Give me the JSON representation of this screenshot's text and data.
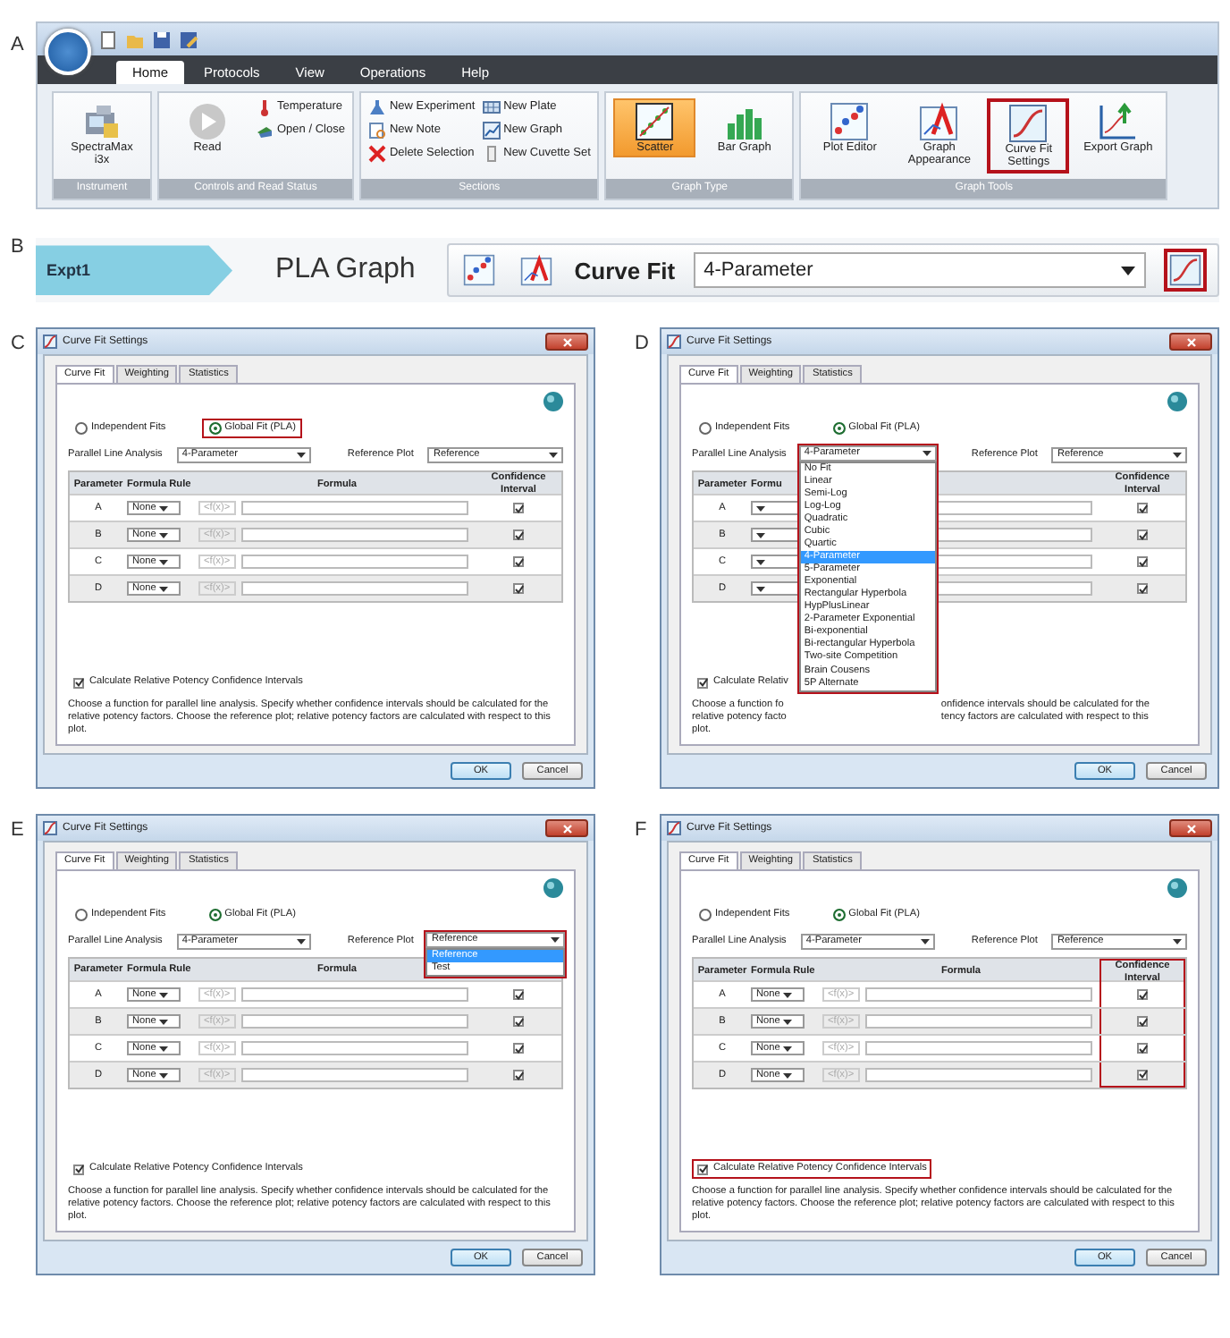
{
  "ribbon": {
    "panel_label": "A",
    "tabs": [
      {
        "label": "Home",
        "selected": true
      },
      {
        "label": "Protocols",
        "selected": false
      },
      {
        "label": "View",
        "selected": false
      },
      {
        "label": "Operations",
        "selected": false
      },
      {
        "label": "Help",
        "selected": false
      }
    ],
    "groups": [
      {
        "label": "Instrument",
        "items": [
          {
            "kind": "large",
            "label": "SpectraMax i3x",
            "selected": false,
            "highlighted": false
          }
        ]
      },
      {
        "label": "Controls and Read Status",
        "items": [
          {
            "kind": "large",
            "label": "Read",
            "selected": false,
            "highlighted": false
          },
          {
            "kind": "small",
            "label": "Temperature"
          },
          {
            "kind": "small",
            "label": "Open / Close"
          }
        ]
      },
      {
        "label": "Sections",
        "items": [
          {
            "kind": "small",
            "label": "New Experiment"
          },
          {
            "kind": "small",
            "label": "New Note"
          },
          {
            "kind": "small",
            "label": "Delete Selection"
          },
          {
            "kind": "small",
            "label": "New Plate"
          },
          {
            "kind": "small",
            "label": "New Graph"
          },
          {
            "kind": "small",
            "label": "New Cuvette Set"
          }
        ]
      },
      {
        "label": "Graph Type",
        "items": [
          {
            "kind": "large",
            "label": "Scatter",
            "selected": true,
            "highlighted": false
          },
          {
            "kind": "large",
            "label": "Bar Graph",
            "selected": false,
            "highlighted": false
          }
        ]
      },
      {
        "label": "Graph Tools",
        "items": [
          {
            "kind": "large",
            "label": "Plot Editor",
            "selected": false,
            "highlighted": false
          },
          {
            "kind": "large",
            "label": "Graph Appearance",
            "selected": false,
            "highlighted": false
          },
          {
            "kind": "large",
            "label": "Curve Fit Settings",
            "selected": false,
            "highlighted": true
          },
          {
            "kind": "large",
            "label": "Export Graph",
            "selected": false,
            "highlighted": false
          }
        ]
      }
    ]
  },
  "graph_bar": {
    "panel_label": "B",
    "experiment": "Expt1",
    "title": "PLA Graph",
    "curve_fit_label": "Curve Fit",
    "curve_fit_value": "4-Parameter",
    "settings_highlighted": true
  },
  "dialogs": [
    {
      "panel_label": "C",
      "title": "Curve Fit Settings",
      "tabs": [
        {
          "label": "Curve Fit",
          "selected": true
        },
        {
          "label": "Weighting",
          "selected": false
        },
        {
          "label": "Statistics",
          "selected": false
        }
      ],
      "fit_options": [
        {
          "label": "Independent Fits",
          "selected": false,
          "highlighted": false
        },
        {
          "label": "Global Fit (PLA)",
          "selected": true,
          "highlighted": true
        }
      ],
      "parallel_line": {
        "label": "Parallel Line Analysis",
        "value": "4-Parameter"
      },
      "reference_plot": {
        "label": "Reference Plot",
        "value": "Reference"
      },
      "columns": {
        "parameter": "Parameter",
        "formula_rule": "Formula Rule",
        "formula": "Formula",
        "confidence": "Confidence Interval"
      },
      "confidence_highlighted": false,
      "rows": [
        {
          "parameter": "A",
          "rule": "None",
          "placeholder": "<f(x)>",
          "confidence": true
        },
        {
          "parameter": "B",
          "rule": "None",
          "placeholder": "<f(x)>",
          "confidence": true
        },
        {
          "parameter": "C",
          "rule": "None",
          "placeholder": "<f(x)>",
          "confidence": true
        },
        {
          "parameter": "D",
          "rule": "None",
          "placeholder": "<f(x)>",
          "confidence": true
        }
      ],
      "relative_potency": {
        "label": "Calculate Relative Potency Confidence Intervals",
        "checked": true
      },
      "description": "Choose a function for parallel line analysis. Specify whether confidence intervals should be calculated for the relative potency factors. Choose the reference plot; relative potency factors are calculated with respect to this plot.",
      "buttons": [
        "OK",
        "Cancel"
      ]
    },
    {
      "panel_label": "D",
      "title": "Curve Fit Settings",
      "tabs": [
        {
          "label": "Curve Fit",
          "selected": true
        },
        {
          "label": "Weighting",
          "selected": false
        },
        {
          "label": "Statistics",
          "selected": false
        }
      ],
      "fit_options": [
        {
          "label": "Independent Fits",
          "selected": false,
          "highlighted": false
        },
        {
          "label": "Global Fit (PLA)",
          "selected": true,
          "highlighted": false
        }
      ],
      "parallel_line": {
        "label": "Parallel Line Analysis",
        "value": "4-Parameter",
        "highlighted": true,
        "open_options": [
          {
            "label": "No Fit",
            "selected": false
          },
          {
            "label": "Linear",
            "selected": false
          },
          {
            "label": "Semi-Log",
            "selected": false
          },
          {
            "label": "Log-Log",
            "selected": false
          },
          {
            "label": "Quadratic",
            "selected": false
          },
          {
            "label": "Cubic",
            "selected": false
          },
          {
            "label": "Quartic",
            "selected": false
          },
          {
            "label": "4-Parameter",
            "selected": true
          },
          {
            "label": "5-Parameter",
            "selected": false
          },
          {
            "label": "Exponential",
            "selected": false
          },
          {
            "label": "Rectangular Hyperbola",
            "selected": false
          },
          {
            "label": "HypPlusLinear",
            "selected": false
          },
          {
            "label": "2-Parameter Exponential",
            "selected": false
          },
          {
            "label": "Bi-exponential",
            "selected": false
          },
          {
            "label": "Bi-rectangular Hyperbola",
            "selected": false
          },
          {
            "label": "Two-site Competition",
            "selected": false
          },
          {
            "label": "Brain Cousens",
            "selected": false
          },
          {
            "label": "5P Alternate",
            "selected": false
          }
        ]
      },
      "reference_plot": {
        "label": "Reference Plot",
        "value": "Reference"
      },
      "columns": {
        "parameter": "Parameter",
        "formula_rule": "Formu",
        "confidence": "Confidence Interval"
      },
      "confidence_highlighted": false,
      "rows": [
        {
          "parameter": "A",
          "confidence": true
        },
        {
          "parameter": "B",
          "confidence": true
        },
        {
          "parameter": "C",
          "confidence": true
        },
        {
          "parameter": "D",
          "confidence": true
        }
      ],
      "relative_potency": {
        "label": "Calculate Relativ",
        "checked": true
      },
      "description_left": [
        "Choose a function fo",
        "relative potency facto",
        "plot."
      ],
      "description_right": [
        "onfidence intervals should be calculated for the",
        "tency factors are calculated with respect to this"
      ],
      "buttons": [
        "OK",
        "Cancel"
      ]
    },
    {
      "panel_label": "E",
      "title": "Curve Fit Settings",
      "tabs": [
        {
          "label": "Curve Fit",
          "selected": true
        },
        {
          "label": "Weighting",
          "selected": false
        },
        {
          "label": "Statistics",
          "selected": false
        }
      ],
      "fit_options": [
        {
          "label": "Independent Fits",
          "selected": false,
          "highlighted": false
        },
        {
          "label": "Global Fit (PLA)",
          "selected": true,
          "highlighted": false
        }
      ],
      "parallel_line": {
        "label": "Parallel Line Analysis",
        "value": "4-Parameter"
      },
      "reference_plot": {
        "label": "Reference Plot",
        "value": "Reference",
        "highlighted": true,
        "open_options": [
          {
            "label": "Reference",
            "selected": true
          },
          {
            "label": "Test",
            "selected": false
          }
        ]
      },
      "columns": {
        "parameter": "Parameter",
        "formula_rule": "Formula Rule",
        "formula": "Formula"
      },
      "confidence_highlighted": false,
      "rows": [
        {
          "parameter": "A",
          "rule": "None",
          "placeholder": "<f(x)>",
          "confidence": true
        },
        {
          "parameter": "B",
          "rule": "None",
          "placeholder": "<f(x)>",
          "confidence": true
        },
        {
          "parameter": "C",
          "rule": "None",
          "placeholder": "<f(x)>",
          "confidence": true
        },
        {
          "parameter": "D",
          "rule": "None",
          "placeholder": "<f(x)>",
          "confidence": true
        }
      ],
      "relative_potency": {
        "label": "Calculate Relative Potency Confidence Intervals",
        "checked": true
      },
      "description": "Choose a function for parallel line analysis. Specify whether confidence intervals should be calculated for the relative potency factors. Choose the reference plot; relative potency factors are calculated with respect to this plot.",
      "buttons": [
        "OK",
        "Cancel"
      ]
    },
    {
      "panel_label": "F",
      "title": "Curve Fit Settings",
      "tabs": [
        {
          "label": "Curve Fit",
          "selected": true
        },
        {
          "label": "Weighting",
          "selected": false
        },
        {
          "label": "Statistics",
          "selected": false
        }
      ],
      "fit_options": [
        {
          "label": "Independent Fits",
          "selected": false,
          "highlighted": false
        },
        {
          "label": "Global Fit (PLA)",
          "selected": true,
          "highlighted": false
        }
      ],
      "parallel_line": {
        "label": "Parallel Line Analysis",
        "value": "4-Parameter"
      },
      "reference_plot": {
        "label": "Reference Plot",
        "value": "Reference"
      },
      "columns": {
        "parameter": "Parameter",
        "formula_rule": "Formula Rule",
        "formula": "Formula",
        "confidence": "Confidence Interval"
      },
      "confidence_highlighted": true,
      "rows": [
        {
          "parameter": "A",
          "rule": "None",
          "placeholder": "<f(x)>",
          "confidence": true
        },
        {
          "parameter": "B",
          "rule": "None",
          "placeholder": "<f(x)>",
          "confidence": true
        },
        {
          "parameter": "C",
          "rule": "None",
          "placeholder": "<f(x)>",
          "confidence": true
        },
        {
          "parameter": "D",
          "rule": "None",
          "placeholder": "<f(x)>",
          "confidence": true
        }
      ],
      "relative_potency": {
        "label": "Calculate Relative Potency Confidence Intervals",
        "checked": true,
        "highlighted": true
      },
      "description": "Choose a function for parallel line analysis. Specify whether confidence intervals should be calculated for the relative potency factors. Choose the reference plot; relative potency factors are calculated with respect to this plot.",
      "buttons": [
        "OK",
        "Cancel"
      ]
    }
  ]
}
